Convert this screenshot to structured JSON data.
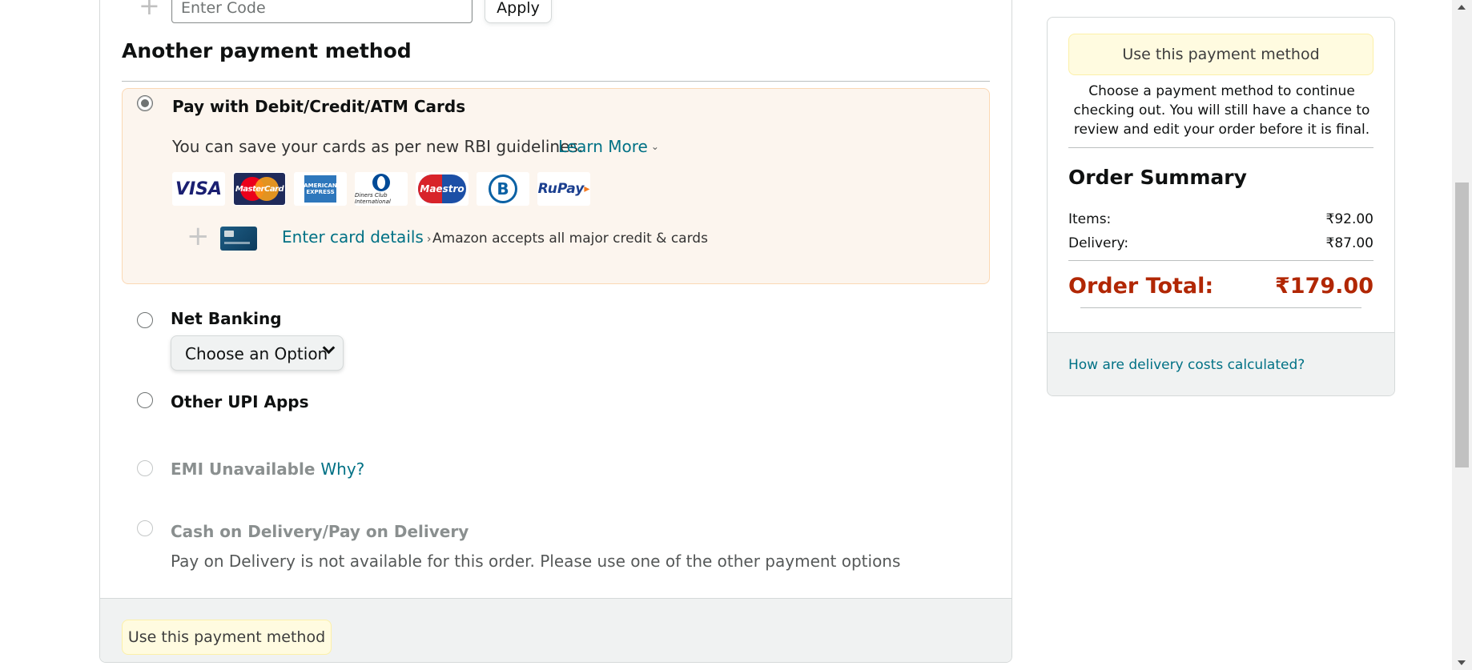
{
  "promo": {
    "plus_icon": "+",
    "code_placeholder": "Enter Code",
    "apply_label": "Apply"
  },
  "payment": {
    "section_title": "Another payment method",
    "card_option": {
      "label": "Pay with Debit/Credit/ATM Cards",
      "selected": true,
      "rbi_text": "You can save your cards as per new RBI guidelines.",
      "learn_more": "Learn More",
      "logos": {
        "visa": "VISA",
        "mastercard": "MasterCard",
        "amex": "AMERICAN EXPRESS",
        "diners": "Diners Club International",
        "maestro": "Maestro",
        "bajaj": "B",
        "rupay": "RuPay"
      },
      "add_icon": "+",
      "enter_card": "Enter card details",
      "accepts_text": "Amazon accepts all major credit & cards"
    },
    "net_banking": {
      "label": "Net Banking",
      "select_value": "Choose an Option"
    },
    "upi": {
      "label": "Other UPI Apps"
    },
    "emi": {
      "label": "EMI Unavailable",
      "why": "Why?"
    },
    "cod": {
      "label": "Cash on Delivery/Pay on Delivery",
      "note": "Pay on Delivery is not available for this order. Please use one of the other payment options"
    },
    "footer_button": "Use this payment method"
  },
  "summary": {
    "button": "Use this payment method",
    "note": "Choose a payment method to continue checking out. You will still have a chance to review and edit your order before it is final.",
    "title": "Order Summary",
    "items_label": "Items:",
    "items_value": "₹92.00",
    "delivery_label": "Delivery:",
    "delivery_value": "₹87.00",
    "total_label": "Order Total:",
    "total_value": "₹179.00",
    "delivery_link": "How are delivery costs calculated?"
  },
  "colors": {
    "link": "#007185",
    "total": "#b12704",
    "selected_bg": "#fcf5ee",
    "button_bg": "#fffbe0"
  }
}
